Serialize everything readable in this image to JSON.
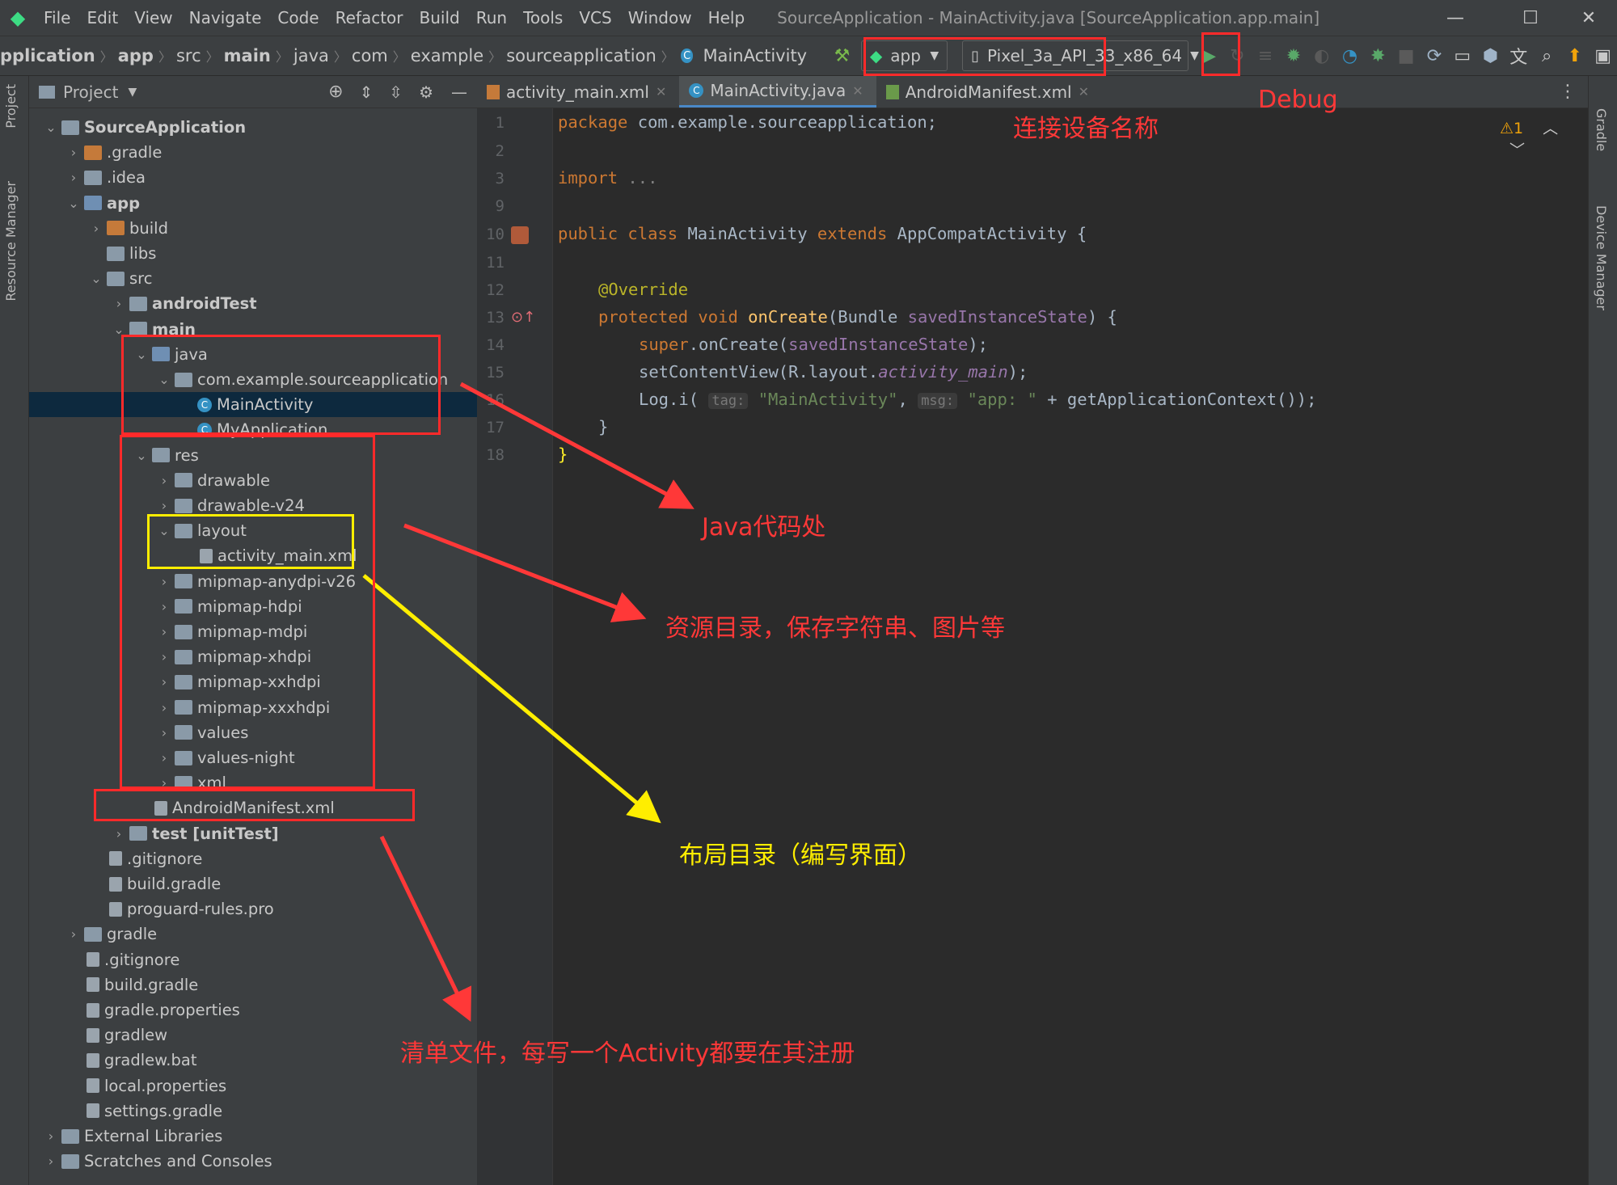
{
  "window": {
    "menus": [
      "File",
      "Edit",
      "View",
      "Navigate",
      "Code",
      "Refactor",
      "Build",
      "Run",
      "Tools",
      "VCS",
      "Window",
      "Help"
    ],
    "title": "SourceApplication - MainActivity.java [SourceApplication.app.main]",
    "controls": {
      "minimize": "—",
      "maximize": "☐",
      "close": "✕"
    }
  },
  "breadcrumb": [
    "pplication",
    "app",
    "src",
    "main",
    "java",
    "com",
    "example",
    "sourceapplication",
    "MainActivity"
  ],
  "toolbar": {
    "run_config": "app",
    "device": "Pixel_3a_API_33_x86_64"
  },
  "project_panel": {
    "title": "Project"
  },
  "tree": [
    {
      "label": "SourceApplication",
      "depth": 0,
      "arrow": "⌄",
      "icon": "fold",
      "bold": true
    },
    {
      "label": ".gradle",
      "depth": 1,
      "arrow": "›",
      "icon": "fold or"
    },
    {
      "label": ".idea",
      "depth": 1,
      "arrow": "›",
      "icon": "fold"
    },
    {
      "label": "app",
      "depth": 1,
      "arrow": "⌄",
      "icon": "fold bl",
      "bold": true
    },
    {
      "label": "build",
      "depth": 2,
      "arrow": "›",
      "icon": "fold or"
    },
    {
      "label": "libs",
      "depth": 2,
      "arrow": "",
      "icon": "fold"
    },
    {
      "label": "src",
      "depth": 2,
      "arrow": "⌄",
      "icon": "fold"
    },
    {
      "label": "androidTest",
      "depth": 3,
      "arrow": "›",
      "icon": "fold",
      "bold": true
    },
    {
      "label": "main",
      "depth": 3,
      "arrow": "⌄",
      "icon": "fold",
      "bold": true
    },
    {
      "label": "java",
      "depth": 4,
      "arrow": "⌄",
      "icon": "fold bl"
    },
    {
      "label": "com.example.sourceapplication",
      "depth": 5,
      "arrow": "⌄",
      "icon": "fold"
    },
    {
      "label": "MainActivity",
      "depth": 6,
      "arrow": "",
      "icon": "cls",
      "selected": true
    },
    {
      "label": "MyApplication",
      "depth": 6,
      "arrow": "",
      "icon": "cls"
    },
    {
      "label": "res",
      "depth": 4,
      "arrow": "⌄",
      "icon": "fold"
    },
    {
      "label": "drawable",
      "depth": 5,
      "arrow": "›",
      "icon": "fold"
    },
    {
      "label": "drawable-v24",
      "depth": 5,
      "arrow": "›",
      "icon": "fold"
    },
    {
      "label": "layout",
      "depth": 5,
      "arrow": "⌄",
      "icon": "fold"
    },
    {
      "label": "activity_main.xml",
      "depth": 6,
      "arrow": "",
      "icon": "file"
    },
    {
      "label": "mipmap-anydpi-v26",
      "depth": 5,
      "arrow": "›",
      "icon": "fold"
    },
    {
      "label": "mipmap-hdpi",
      "depth": 5,
      "arrow": "›",
      "icon": "fold"
    },
    {
      "label": "mipmap-mdpi",
      "depth": 5,
      "arrow": "›",
      "icon": "fold"
    },
    {
      "label": "mipmap-xhdpi",
      "depth": 5,
      "arrow": "›",
      "icon": "fold"
    },
    {
      "label": "mipmap-xxhdpi",
      "depth": 5,
      "arrow": "›",
      "icon": "fold"
    },
    {
      "label": "mipmap-xxxhdpi",
      "depth": 5,
      "arrow": "›",
      "icon": "fold"
    },
    {
      "label": "values",
      "depth": 5,
      "arrow": "›",
      "icon": "fold"
    },
    {
      "label": "values-night",
      "depth": 5,
      "arrow": "›",
      "icon": "fold"
    },
    {
      "label": "xml",
      "depth": 5,
      "arrow": "›",
      "icon": "fold"
    },
    {
      "label": "AndroidManifest.xml",
      "depth": 4,
      "arrow": "",
      "icon": "file"
    },
    {
      "label": "test [unitTest]",
      "depth": 3,
      "arrow": "›",
      "icon": "fold",
      "bold": true
    },
    {
      "label": ".gitignore",
      "depth": 2,
      "arrow": "",
      "icon": "file"
    },
    {
      "label": "build.gradle",
      "depth": 2,
      "arrow": "",
      "icon": "file"
    },
    {
      "label": "proguard-rules.pro",
      "depth": 2,
      "arrow": "",
      "icon": "file"
    },
    {
      "label": "gradle",
      "depth": 1,
      "arrow": "›",
      "icon": "fold"
    },
    {
      "label": ".gitignore",
      "depth": 1,
      "arrow": "",
      "icon": "file"
    },
    {
      "label": "build.gradle",
      "depth": 1,
      "arrow": "",
      "icon": "file"
    },
    {
      "label": "gradle.properties",
      "depth": 1,
      "arrow": "",
      "icon": "file"
    },
    {
      "label": "gradlew",
      "depth": 1,
      "arrow": "",
      "icon": "file"
    },
    {
      "label": "gradlew.bat",
      "depth": 1,
      "arrow": "",
      "icon": "file"
    },
    {
      "label": "local.properties",
      "depth": 1,
      "arrow": "",
      "icon": "file"
    },
    {
      "label": "settings.gradle",
      "depth": 1,
      "arrow": "",
      "icon": "file"
    },
    {
      "label": "External Libraries",
      "depth": 0,
      "arrow": "›",
      "icon": "fold"
    },
    {
      "label": "Scratches and Consoles",
      "depth": 0,
      "arrow": "›",
      "icon": "fold"
    }
  ],
  "tabs": [
    {
      "label": "activity_main.xml",
      "active": false
    },
    {
      "label": "MainActivity.java",
      "active": true
    },
    {
      "label": "AndroidManifest.xml",
      "active": false
    }
  ],
  "side_tabs": {
    "left": [
      "Project",
      "Resource Manager"
    ],
    "right": [
      "Gradle",
      "Device Manager"
    ]
  },
  "inspection": "⚠1",
  "code": {
    "line_numbers": [
      "1",
      "2",
      "3",
      "9",
      "10",
      "11",
      "12",
      "13",
      "14",
      "15",
      "16",
      "17",
      "18"
    ],
    "package_kw": "package",
    "package_name": " com.example.sourceapplication;",
    "import_kw": "import",
    "import_fold": " ...",
    "l10_public": "public ",
    "l10_class": "class ",
    "l10_name": "MainActivity ",
    "l10_extends": "extends ",
    "l10_rest": "AppCompatActivity {",
    "l12_ann": "@Override",
    "l13_mods": "protected void ",
    "l13_fn": "onCreate",
    "l13_params": "(Bundle ",
    "l13_param": "savedInstanceState",
    "l13_end": ") {",
    "l14_super": "super",
    "l14_mid": ".onCreate(",
    "l14_arg": "savedInstanceState",
    "l14_end": ");",
    "l15_a": "setContentView(R.layout.",
    "l15_b": "activity_main",
    "l15_c": ");",
    "l16_a": "Log.i( ",
    "l16_tag": "tag:",
    "l16_s1": " \"MainActivity\"",
    "l16_comma": ", ",
    "l16_msg": "msg:",
    "l16_s2": " \"app: \"",
    "l16_rest": " + getApplicationContext());",
    "l17": "}",
    "l18": "}"
  },
  "annotations": {
    "device_note": "连接设备名称",
    "debug_note": "Debug",
    "java_note": "Java代码处",
    "res_note": "资源目录，保存字符串、图片等",
    "layout_note": "布局目录（编写界面）",
    "manifest_note": "清单文件，每写一个Activity都要在其注册"
  },
  "colors": {
    "annotation_red": "#ff3838",
    "annotation_yellow": "#ffee00",
    "selection": "#0d293e",
    "android_green": "#3ddc84"
  }
}
